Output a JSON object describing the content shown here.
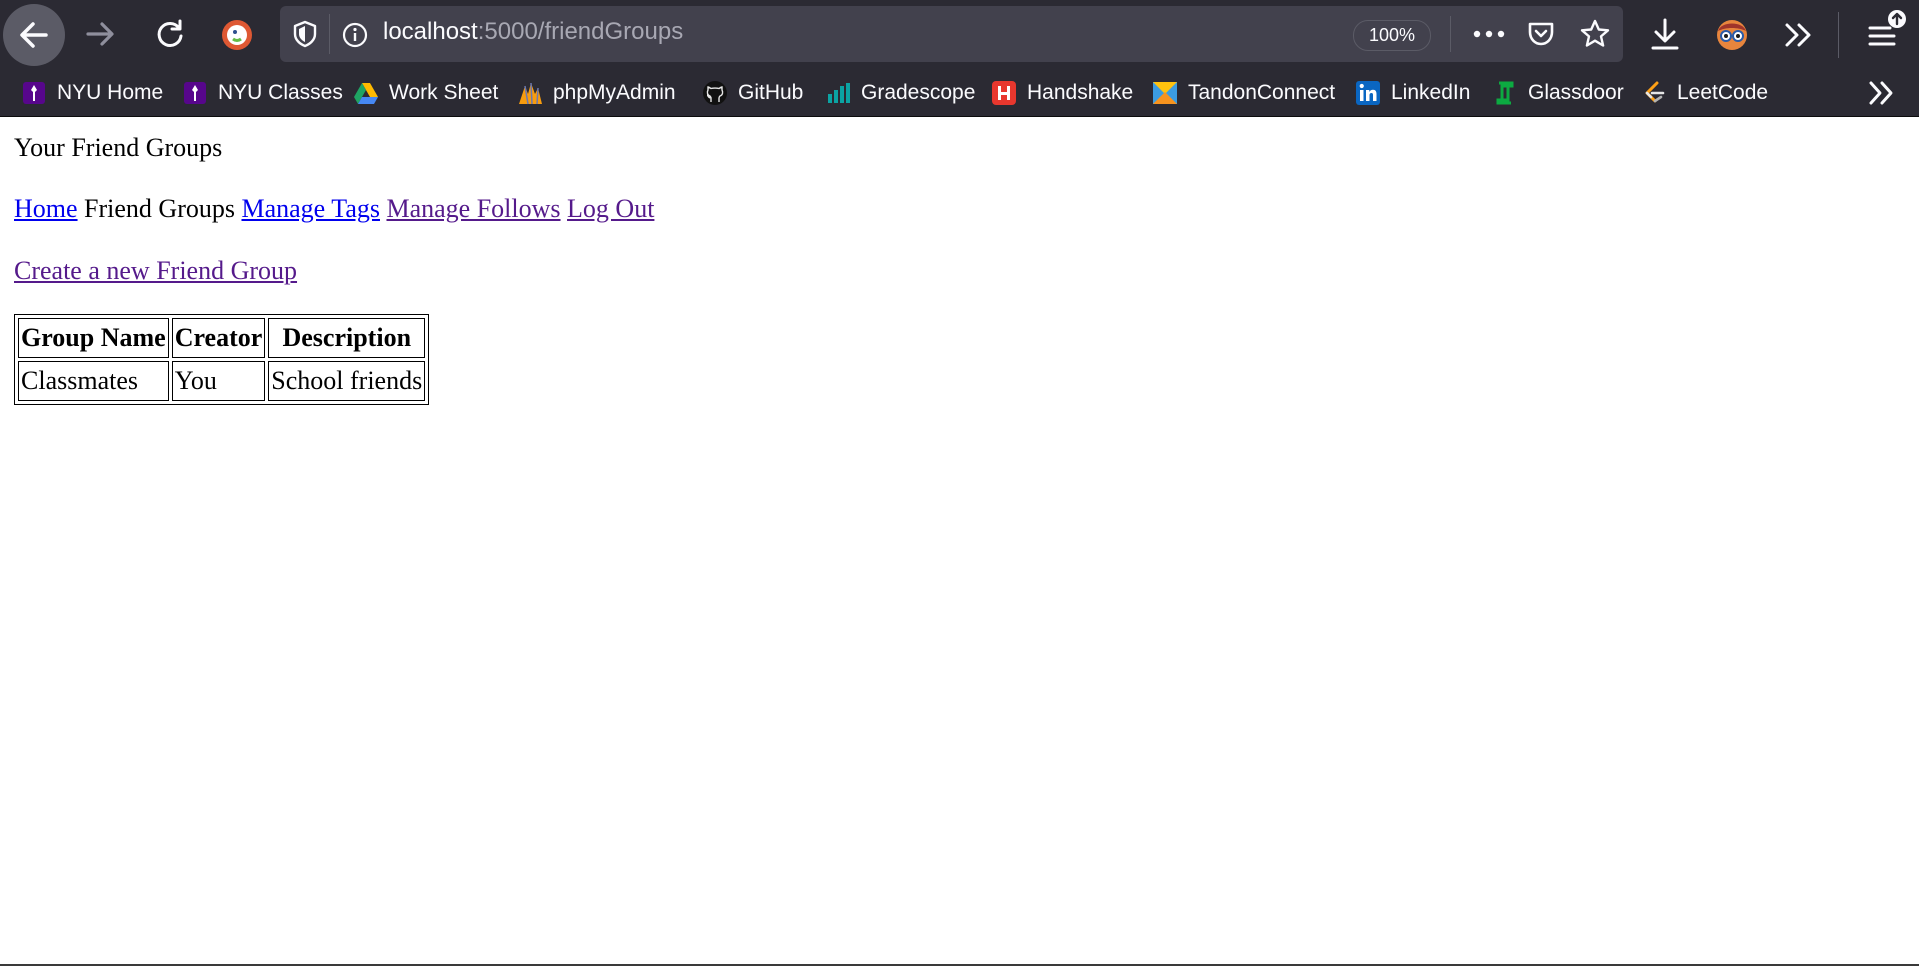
{
  "browser": {
    "url_host": "localhost",
    "url_path": ":5000/friendGroups",
    "zoom": "100%",
    "bookmarks": [
      {
        "label": "NYU Home",
        "icon": "nyu-torch-icon",
        "color": "#57068c"
      },
      {
        "label": "NYU Classes",
        "icon": "nyu-torch-icon",
        "color": "#57068c"
      },
      {
        "label": "Work Sheet",
        "icon": "google-drive-icon",
        "color": "#1fa463"
      },
      {
        "label": "phpMyAdmin",
        "icon": "phpmyadmin-icon",
        "color": "#f89c0e"
      },
      {
        "label": "GitHub",
        "icon": "github-icon",
        "color": "#111111"
      },
      {
        "label": "Gradescope",
        "icon": "gradescope-icon",
        "color": "#0ba3a3"
      },
      {
        "label": "Handshake",
        "icon": "handshake-icon",
        "color": "#e8372e"
      },
      {
        "label": "TandonConnect",
        "icon": "tandonconnect-icon",
        "color": "#3b9be0"
      },
      {
        "label": "LinkedIn",
        "icon": "linkedin-icon",
        "color": "#0a66c2"
      },
      {
        "label": "Glassdoor",
        "icon": "glassdoor-icon",
        "color": "#0caa41"
      },
      {
        "label": "LeetCode",
        "icon": "leetcode-icon",
        "color": "#ffa116"
      }
    ]
  },
  "page": {
    "heading": "Your Friend Groups",
    "nav": {
      "home": "Home",
      "friend_groups": "Friend Groups",
      "manage_tags": "Manage Tags",
      "manage_follows": "Manage Follows",
      "log_out": "Log Out"
    },
    "create_link": "Create a new Friend Group",
    "table": {
      "headers": [
        "Group Name",
        "Creator",
        "Description"
      ],
      "rows": [
        [
          "Classmates",
          "You",
          "School friends"
        ]
      ]
    }
  },
  "colors": {
    "link": "#0000ee",
    "visited_link": "#551a8b",
    "chrome_bg": "#2b2a33"
  }
}
